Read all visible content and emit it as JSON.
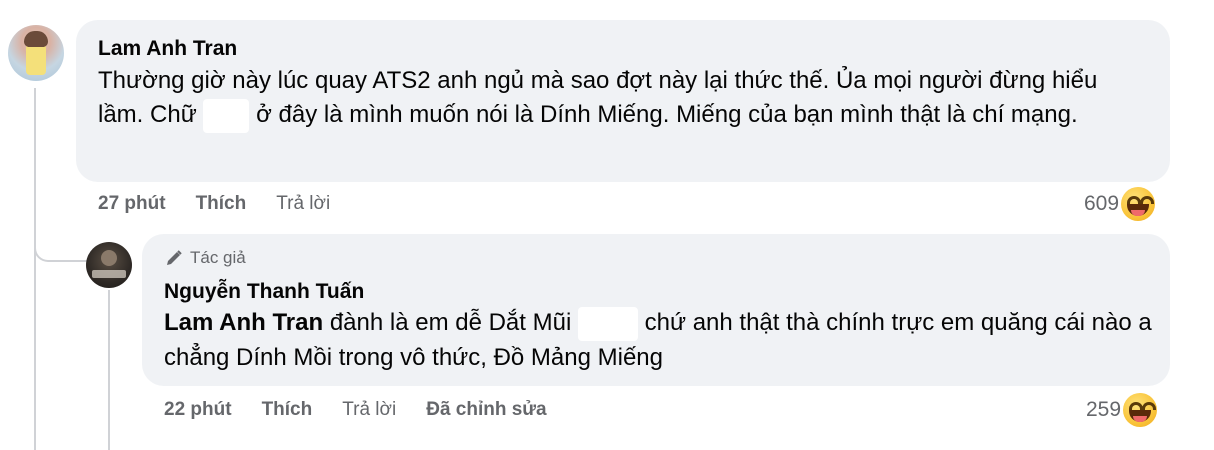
{
  "comment1": {
    "author": "Lam Anh Tran",
    "text_part1": "Thường giờ này lúc quay ATS2 anh ngủ mà sao đợt này lại thức thế. Ủa mọi người đừng hiểu lầm. Chữ",
    "text_part2": "ở đây là mình muốn nói là Dính Miếng. Miếng của bạn mình thật là chí mạng.",
    "time": "27 phút",
    "like_label": "Thích",
    "reply_label": "Trả lời",
    "reaction_count": "609",
    "reaction_icon": "laughing-emoji-icon"
  },
  "reply1": {
    "badge": "Tác giả",
    "badge_icon": "pen-icon",
    "author": "Nguyễn Thanh Tuấn",
    "mention": "Lam Anh Tran",
    "text_part1": "đành là em dễ Dắt Mũi",
    "text_part2": "chứ anh thật thà chính trực em quăng cái nào a chẳng Dính Mồi trong vô thức, Đồ Mảng Miếng",
    "time": "22 phút",
    "like_label": "Thích",
    "reply_label": "Trả lời",
    "edited_label": "Đã chỉnh sửa",
    "reaction_count": "259",
    "reaction_icon": "laughing-emoji-icon"
  }
}
